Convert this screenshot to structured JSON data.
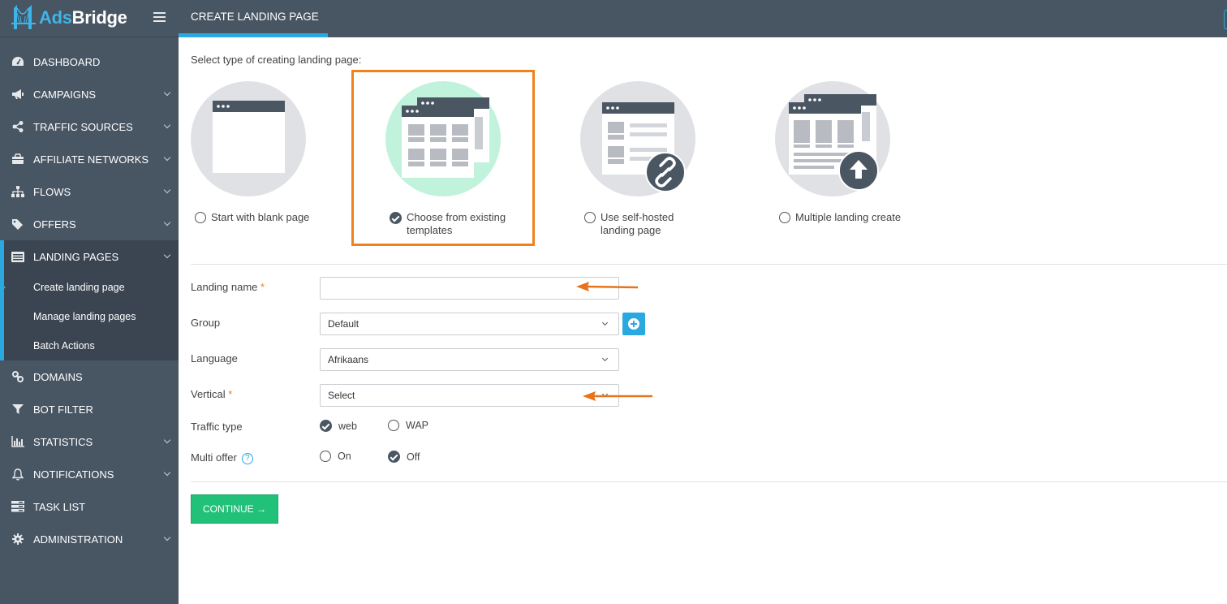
{
  "app": {
    "logo_part1": "Ads",
    "logo_part2": "Bridge",
    "page_title": "CREATE LANDING PAGE"
  },
  "sidebar": {
    "items": [
      {
        "label": "DASHBOARD",
        "icon": "dashboard-icon"
      },
      {
        "label": "CAMPAIGNS",
        "icon": "megaphone-icon"
      },
      {
        "label": "TRAFFIC SOURCES",
        "icon": "share-icon"
      },
      {
        "label": "AFFILIATE NETWORKS",
        "icon": "briefcase-icon"
      },
      {
        "label": "FLOWS",
        "icon": "sitemap-icon"
      },
      {
        "label": "OFFERS",
        "icon": "tags-icon"
      },
      {
        "label": "LANDING PAGES",
        "icon": "list-icon"
      },
      {
        "label": "DOMAINS",
        "icon": "link-icon"
      },
      {
        "label": "BOT FILTER",
        "icon": "filter-icon"
      },
      {
        "label": "STATISTICS",
        "icon": "bar-chart-icon"
      },
      {
        "label": "NOTIFICATIONS",
        "icon": "bell-icon"
      },
      {
        "label": "TASK LIST",
        "icon": "tasks-icon"
      },
      {
        "label": "ADMINISTRATION",
        "icon": "gear-icon"
      }
    ],
    "landing_sub": [
      {
        "label": "Create landing page"
      },
      {
        "label": "Manage landing pages"
      },
      {
        "label": "Batch Actions"
      }
    ]
  },
  "main": {
    "select_type_label": "Select type of creating landing page:",
    "options": [
      {
        "label": "Start with blank page",
        "selected": false
      },
      {
        "label_line1": "Choose from existing",
        "label_line2": "templates",
        "selected": true
      },
      {
        "label_line1": "Use self-hosted",
        "label_line2": "landing page",
        "selected": false
      },
      {
        "label": "Multiple landing create",
        "selected": false
      }
    ],
    "form": {
      "landing_name_label": "Landing name",
      "landing_name_value": "",
      "group_label": "Group",
      "group_value": "Default",
      "language_label": "Language",
      "language_value": "Afrikaans",
      "vertical_label": "Vertical",
      "vertical_value": "Select",
      "required_mark": "*",
      "traffic_type_label": "Traffic type",
      "traffic_web": "web",
      "traffic_wap": "WAP",
      "traffic_selected": "web",
      "multi_offer_label": "Multi offer",
      "multi_on": "On",
      "multi_off": "Off",
      "multi_selected": "Off",
      "help_glyph": "?"
    },
    "continue_label": "CONTINUE →"
  },
  "colors": {
    "sidebar_bg": "#485563",
    "accent_blue": "#29a9e0",
    "highlight_orange": "#f0821e",
    "continue_green": "#22c17a",
    "selected_circle_green": "#c1f3dc"
  }
}
